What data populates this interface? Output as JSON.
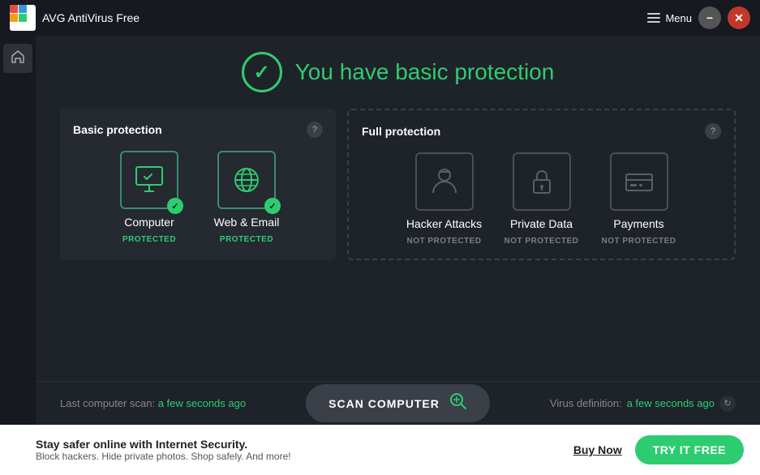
{
  "app": {
    "name": "AVG AntiVirus Free"
  },
  "titlebar": {
    "menu_label": "Menu",
    "minimize_label": "−",
    "close_label": "✕"
  },
  "header": {
    "title": "You have basic protection"
  },
  "basic_protection": {
    "title": "Basic protection",
    "help_label": "?",
    "items": [
      {
        "name": "Computer",
        "status": "PROTECTED",
        "type": "protected"
      },
      {
        "name": "Web & Email",
        "status": "PROTECTED",
        "type": "protected"
      }
    ]
  },
  "full_protection": {
    "title": "Full protection",
    "help_label": "?",
    "items": [
      {
        "name": "Hacker Attacks",
        "status": "NOT PROTECTED",
        "type": "not_protected"
      },
      {
        "name": "Private Data",
        "status": "NOT PROTECTED",
        "type": "not_protected"
      },
      {
        "name": "Payments",
        "status": "NOT PROTECTED",
        "type": "not_protected"
      }
    ]
  },
  "scan_bar": {
    "last_scan_label": "Last computer scan:",
    "last_scan_time": "a few seconds ago",
    "scan_button_label": "SCAN COMPUTER",
    "virus_def_label": "Virus definition:",
    "virus_def_time": "a few seconds ago"
  },
  "footer": {
    "title": "Stay safer online with Internet Security.",
    "subtitle": "Block hackers. Hide private photos. Shop safely. And more!",
    "buy_now_label": "Buy Now",
    "try_free_label": "TRY IT FREE"
  }
}
